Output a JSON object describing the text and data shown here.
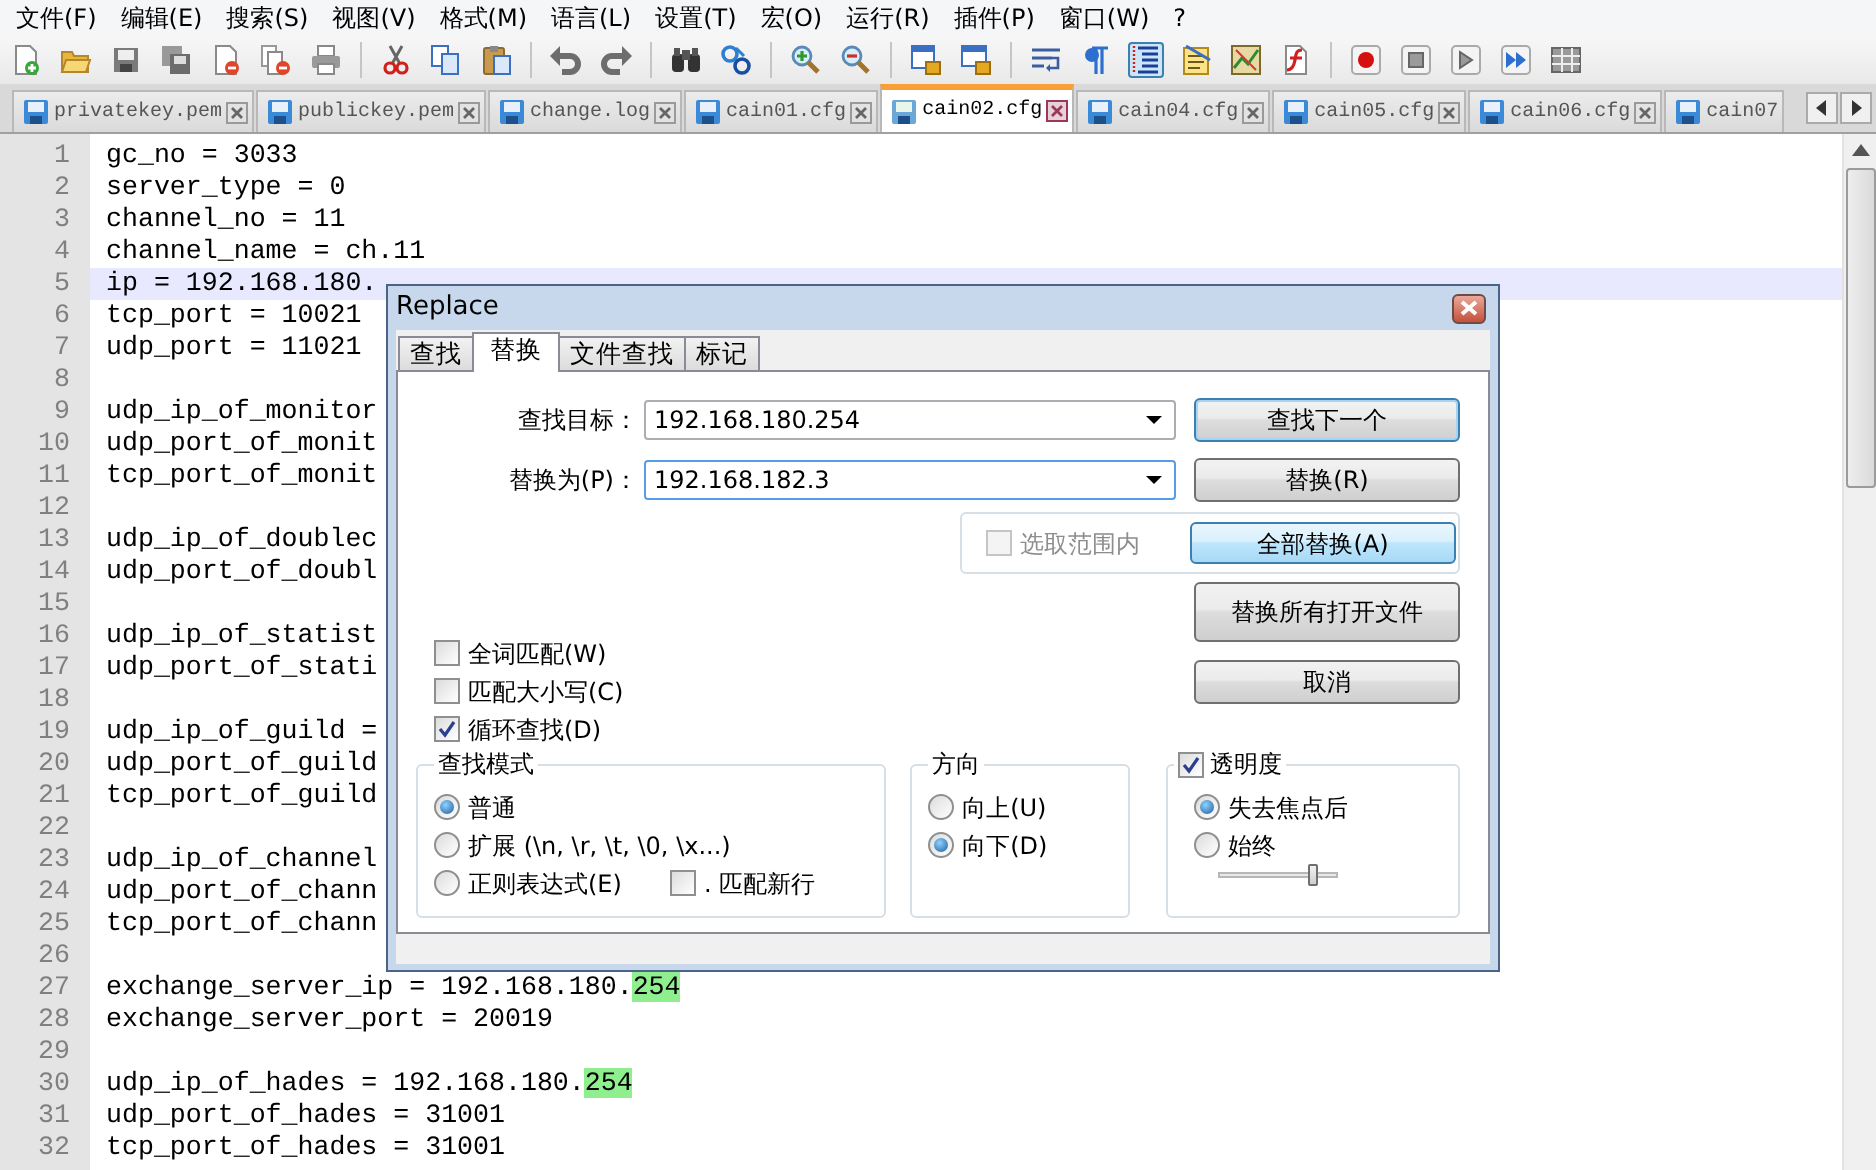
{
  "menu": [
    "文件(F)",
    "编辑(E)",
    "搜索(S)",
    "视图(V)",
    "格式(M)",
    "语言(L)",
    "设置(T)",
    "宏(O)",
    "运行(R)",
    "插件(P)",
    "窗口(W)",
    "?"
  ],
  "toolbar": [
    {
      "kind": "button",
      "pressed": false
    },
    {
      "kind": "button",
      "pressed": false
    },
    {
      "kind": "button",
      "pressed": false
    },
    {
      "kind": "button",
      "pressed": false
    },
    {
      "kind": "button",
      "pressed": false
    },
    {
      "kind": "button",
      "pressed": false
    },
    {
      "kind": "button",
      "pressed": false
    },
    {
      "kind": "separator"
    },
    {
      "kind": "button",
      "pressed": false
    },
    {
      "kind": "button",
      "pressed": false
    },
    {
      "kind": "button",
      "pressed": false
    },
    {
      "kind": "separator"
    },
    {
      "kind": "button",
      "pressed": false
    },
    {
      "kind": "button",
      "pressed": false
    },
    {
      "kind": "separator"
    },
    {
      "kind": "button",
      "pressed": false
    },
    {
      "kind": "button",
      "pressed": false
    },
    {
      "kind": "separator"
    },
    {
      "kind": "button",
      "pressed": false
    },
    {
      "kind": "button",
      "pressed": false
    },
    {
      "kind": "separator"
    },
    {
      "kind": "button",
      "pressed": false
    },
    {
      "kind": "button",
      "pressed": false
    },
    {
      "kind": "separator"
    },
    {
      "kind": "button",
      "pressed": false
    },
    {
      "kind": "button",
      "pressed": false
    },
    {
      "kind": "button",
      "pressed": true
    },
    {
      "kind": "button",
      "pressed": false
    },
    {
      "kind": "button",
      "pressed": false
    },
    {
      "kind": "button",
      "pressed": false
    },
    {
      "kind": "separator"
    },
    {
      "kind": "button",
      "pressed": false
    },
    {
      "kind": "button",
      "pressed": false
    },
    {
      "kind": "button",
      "pressed": false
    },
    {
      "kind": "button",
      "pressed": false
    },
    {
      "kind": "button",
      "pressed": false
    }
  ],
  "tabs": [
    {
      "label": "privatekey.pem",
      "selected": false
    },
    {
      "label": "publickey.pem",
      "selected": false
    },
    {
      "label": "change.log",
      "selected": false
    },
    {
      "label": "cain01.cfg",
      "selected": false
    },
    {
      "label": "cain02.cfg",
      "selected": true
    },
    {
      "label": "cain04.cfg",
      "selected": false
    },
    {
      "label": "cain05.cfg",
      "selected": false
    },
    {
      "label": "cain06.cfg",
      "selected": false
    },
    {
      "label": "cain07",
      "selected": false
    }
  ],
  "editor": {
    "lines": [
      {
        "number": "1",
        "text": "gc_no = 3033",
        "current": false
      },
      {
        "number": "2",
        "text": "server_type = 0",
        "current": false
      },
      {
        "number": "3",
        "text": "channel_no = 11",
        "current": false
      },
      {
        "number": "4",
        "text": "channel_name = ch.11",
        "current": false
      },
      {
        "number": "5",
        "text": "ip = 192.168.180.",
        "current": true
      },
      {
        "number": "6",
        "text": "tcp_port = 10021",
        "current": false
      },
      {
        "number": "7",
        "text": "udp_port = 11021",
        "current": false
      },
      {
        "number": "8",
        "current": false
      },
      {
        "number": "9",
        "text": "udp_ip_of_monitor",
        "current": false
      },
      {
        "number": "10",
        "text": "udp_port_of_monit",
        "current": false
      },
      {
        "number": "11",
        "text": "tcp_port_of_monit",
        "current": false
      },
      {
        "number": "12",
        "current": false
      },
      {
        "number": "13",
        "text": "udp_ip_of_doublec",
        "current": false
      },
      {
        "number": "14",
        "text": "udp_port_of_doubl",
        "current": false
      },
      {
        "number": "15",
        "current": false
      },
      {
        "number": "16",
        "text": "udp_ip_of_statist",
        "current": false
      },
      {
        "number": "17",
        "text": "udp_port_of_stati",
        "current": false
      },
      {
        "number": "18",
        "current": false
      },
      {
        "number": "19",
        "text": "udp_ip_of_guild =",
        "current": false
      },
      {
        "number": "20",
        "text": "udp_port_of_guild",
        "current": false
      },
      {
        "number": "21",
        "text": "tcp_port_of_guild",
        "current": false
      },
      {
        "number": "22",
        "current": false
      },
      {
        "number": "23",
        "text": "udp_ip_of_channel",
        "current": false
      },
      {
        "number": "24",
        "text": "udp_port_of_chann",
        "current": false
      },
      {
        "number": "25",
        "text": "tcp_port_of_chann",
        "current": false
      },
      {
        "number": "26",
        "current": false
      },
      {
        "number": "27",
        "text": "exchange_server_ip = 192.168.180.",
        "match": "254",
        "current": false
      },
      {
        "number": "28",
        "text": "exchange_server_port = 20019",
        "current": false
      },
      {
        "number": "29",
        "current": false
      },
      {
        "number": "30",
        "text": "udp_ip_of_hades = 192.168.180.",
        "match": "254",
        "current": false
      },
      {
        "number": "31",
        "text": "udp_port_of_hades = 31001",
        "current": false
      },
      {
        "number": "32",
        "text": "tcp_port_of_hades = 31001",
        "current": false
      }
    ]
  },
  "dialog": {
    "title": "Replace",
    "tabs": [
      {
        "label": "查找",
        "selected": false
      },
      {
        "label": "替换",
        "selected": true
      },
      {
        "label": "文件查找",
        "selected": false
      },
      {
        "label": "标记",
        "selected": false
      }
    ],
    "fields": [
      {
        "label": "查找目标：",
        "value": "192.168.180.254"
      },
      {
        "label": "替换为(P)：",
        "value": "192.168.182.3"
      }
    ],
    "in_selection": {
      "label": "选取范围内",
      "checked": false,
      "disabled": true
    },
    "buttons": [
      {
        "label": "查找下一个",
        "default": true,
        "hot": false
      },
      {
        "label": "替换(R)",
        "default": false,
        "hot": false
      },
      {
        "label": "全部替换(A)",
        "default": false,
        "hot": true
      },
      {
        "label": "替换所有打开文件",
        "default": false,
        "hot": false
      },
      {
        "label": "取消",
        "default": false,
        "hot": false
      }
    ],
    "options": [
      {
        "label": "全词匹配(W)",
        "checked": false
      },
      {
        "label": "匹配大小写(C)",
        "checked": false
      },
      {
        "label": "循环查找(D)",
        "checked": true
      }
    ],
    "search_mode": {
      "title": "查找模式",
      "options": [
        {
          "label": "普通",
          "selected": true
        },
        {
          "label": "扩展 (\\n, \\r, \\t, \\0, \\x...)",
          "selected": false
        },
        {
          "label": "正则表达式(E)",
          "selected": false
        }
      ],
      "dot_newline": {
        "label": ". 匹配新行",
        "checked": false
      }
    },
    "direction": {
      "title": "方向",
      "options": [
        {
          "label": "向上(U)",
          "selected": false
        },
        {
          "label": "向下(D)",
          "selected": true
        }
      ]
    },
    "transparency": {
      "label": "透明度",
      "checked": true,
      "options": [
        {
          "label": "失去焦点后",
          "selected": true
        },
        {
          "label": "始终",
          "selected": false
        }
      ],
      "level": 0.8
    }
  }
}
